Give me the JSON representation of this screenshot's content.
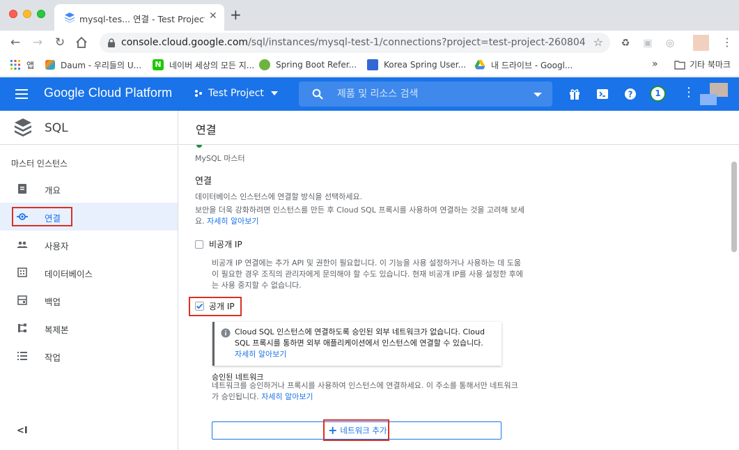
{
  "browser": {
    "tab_title": "mysql-tes... 연결 - Test Project",
    "url_host": "console.cloud.google.com",
    "url_path": "/sql/instances/mysql-test-1/connections?project=test-project-260804",
    "bookmarks": [
      {
        "label": "앱",
        "icon": "apps-grid-icon"
      },
      {
        "label": "Daum - 우리들의 U...",
        "icon": "daum-icon"
      },
      {
        "label": "네이버 세상의 모든 지...",
        "icon": "naver-icon"
      },
      {
        "label": "Spring Boot Refer...",
        "icon": "spring-icon"
      },
      {
        "label": "Korea Spring User...",
        "icon": "ksug-icon"
      },
      {
        "label": "내 드라이브 - Googl...",
        "icon": "drive-icon"
      }
    ],
    "bookmarks_more": "»",
    "bookmarks_folder": "기타 북마크"
  },
  "header": {
    "title": "Google Cloud Platform",
    "project": "Test Project",
    "search_placeholder": "제품 및 리소스 검색",
    "notification_count": "1"
  },
  "sidebar": {
    "product": "SQL",
    "section": "마스터 인스턴스",
    "items": [
      {
        "label": "개요",
        "icon": "overview-icon"
      },
      {
        "label": "연결",
        "icon": "connections-icon"
      },
      {
        "label": "사용자",
        "icon": "users-icon"
      },
      {
        "label": "데이터베이스",
        "icon": "databases-icon"
      },
      {
        "label": "백업",
        "icon": "backups-icon"
      },
      {
        "label": "복제본",
        "icon": "replicas-icon"
      },
      {
        "label": "작업",
        "icon": "operations-icon"
      }
    ],
    "collapse": "<I"
  },
  "main": {
    "title": "연결",
    "instance_type": "MySQL 마스터",
    "section_title": "연결",
    "desc_line1": "데이터베이스 인스턴스에 연결할 방식을 선택하세요.",
    "desc_line2": "보안을 더욱 강화하려면 인스턴스를 만든 후 Cloud SQL 프록시를 사용하여 연결하는 것을 고려해 보세",
    "desc_line3_prefix": "요.",
    "learn_more": "자세히 알아보기",
    "private_ip": {
      "label": "비공개 IP",
      "checked": false,
      "desc_line1": "비공개 IP 연결에는 추가 API 및 권한이 필요합니다. 이 기능을 사용 설정하거나 사용하는 데 도움",
      "desc_line2": "이 필요한 경우 조직의 관리자에게 문의해야 할 수도 있습니다. 현재 비공개 IP를 사용 설정한 후에",
      "desc_line3": "는 사용 중지할 수 없습니다."
    },
    "public_ip": {
      "label": "공개 IP",
      "checked": true,
      "info_line1": "Cloud SQL 인스턴스에 연결하도록 승인된 외부 네트워크가 없습니다. Cloud",
      "info_line2": "SQL 프록시를 통하면 외부 애플리케이션에서 인스턴스에 연결할 수 있습니다.",
      "info_link": "자세히 알아보기"
    },
    "authorized_networks": {
      "title": "승인된 네트워크",
      "desc_line1": "네트워크를 승인하거나 프록시를 사용하여 인스턴스에 연결하세요. 이 주소를 통해서만 네트워크",
      "desc_line2_prefix": "가 승인됩니다.",
      "learn_more": "자세히 알아보기",
      "add_button": "네트워크 추가"
    }
  },
  "colors": {
    "gcp_blue": "#1a73e8",
    "highlight_red": "#d93025",
    "active_bg": "#e8f0fe"
  }
}
